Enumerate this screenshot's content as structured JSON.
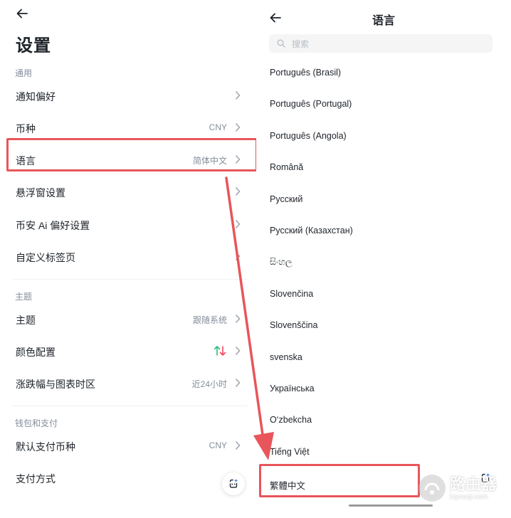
{
  "left": {
    "title": "设置",
    "sections": {
      "general": {
        "title": "通用",
        "rows": [
          {
            "label": "通知偏好",
            "value": ""
          },
          {
            "label": "币种",
            "value": "CNY"
          },
          {
            "label": "语言",
            "value": "简体中文"
          },
          {
            "label": "悬浮窗设置",
            "value": ""
          },
          {
            "label": "币安 Ai 偏好设置",
            "value": ""
          },
          {
            "label": "自定义标签页",
            "value": ""
          }
        ]
      },
      "theme": {
        "title": "主题",
        "rows": [
          {
            "label": "主题",
            "value": "跟随系统"
          },
          {
            "label": "颜色配置",
            "value": ""
          },
          {
            "label": "涨跌幅与图表时区",
            "value": "近24小时"
          }
        ]
      },
      "wallet": {
        "title": "钱包和支付",
        "rows": [
          {
            "label": "默认支付币种",
            "value": "CNY"
          },
          {
            "label": "支付方式",
            "value": ""
          }
        ]
      }
    },
    "color_config_colors": {
      "up": "#2ebd85",
      "down": "#f6465d"
    }
  },
  "right": {
    "title": "语言",
    "search_placeholder": "搜索",
    "languages": [
      "Português (Brasil)",
      "Português (Portugal)",
      "Português (Angola)",
      "Română",
      "Русский",
      "Русский (Казахстан)",
      "සිංහල",
      "Slovenčina",
      "Slovenščina",
      "svenska",
      "Українська",
      "O‘zbekcha",
      "Tiếng Việt",
      "繁體中文"
    ]
  },
  "watermark": {
    "text_cn": "路由器",
    "text_en": "luyouqi.com"
  },
  "colors": {
    "highlight": "#e8555a",
    "text": "#1e2329",
    "muted": "#848e9c"
  }
}
